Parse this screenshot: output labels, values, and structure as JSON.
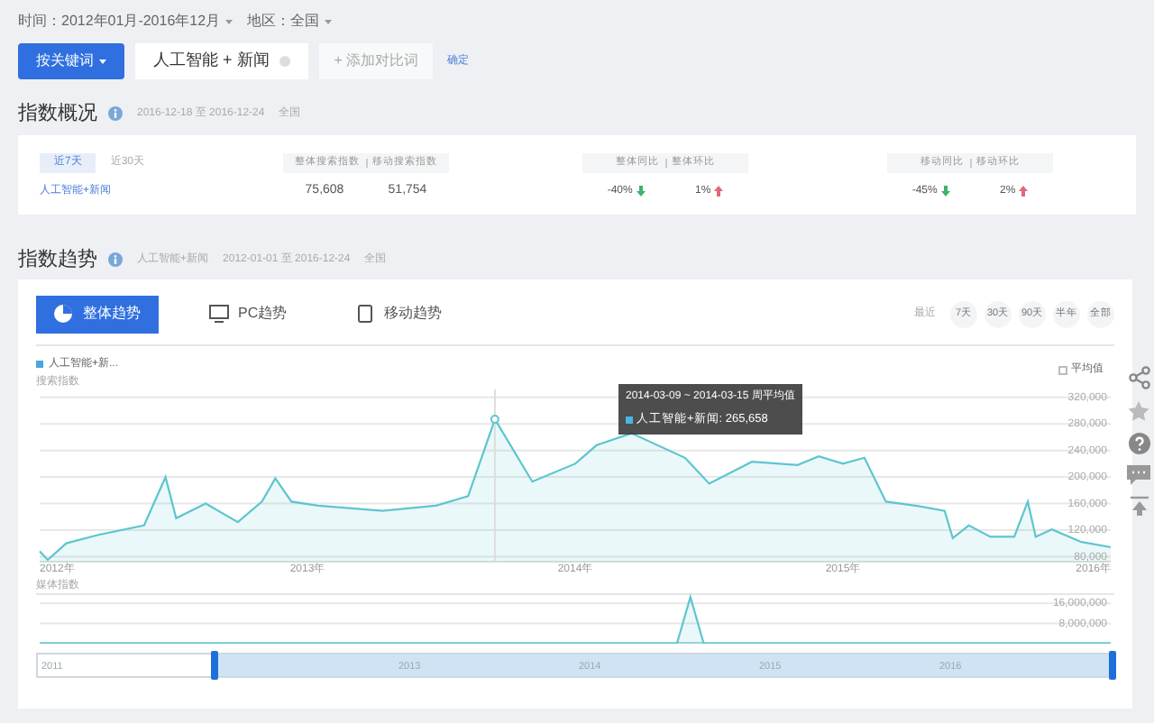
{
  "filters": [
    {
      "label": "时间：2012年01月-2016年12月"
    },
    {
      "label": "地区：全国"
    }
  ],
  "toolbar": {
    "mode_button": "按关键词",
    "keyword": "人工智能 + 新闻",
    "add_compare": "+ 添加对比词",
    "confirm": "确定"
  },
  "overview": {
    "title": "指数概况",
    "date_range": "2016-12-18 至 2016-12-24",
    "region": "全国",
    "tabs": [
      {
        "label": "近7天",
        "selected": true
      },
      {
        "label": "近30天",
        "selected": false
      }
    ],
    "header_groups": [
      [
        "整体搜索指数",
        "移动搜索指数"
      ],
      [
        "整体同比",
        "整体环比"
      ],
      [
        "移动同比",
        "移动环比"
      ]
    ],
    "row": {
      "keyword": "人工智能+新闻",
      "overall": "75,608",
      "mobile": "51,754",
      "changes": [
        {
          "value": "-40%",
          "rising": false
        },
        {
          "value": "1%",
          "rising": true
        },
        {
          "value": "-45%",
          "rising": false
        },
        {
          "value": "2%",
          "rising": true
        }
      ]
    }
  },
  "trend": {
    "title": "指数趋势",
    "keyword": "人工智能+新闻",
    "date_range": "2012-01-01 至 2016-12-24",
    "region": "全国",
    "tabs": [
      {
        "label": "整体趋势",
        "kind": "pie",
        "selected": true
      },
      {
        "label": "PC趋势",
        "kind": "monitor",
        "selected": false
      },
      {
        "label": "移动趋势",
        "kind": "phone",
        "selected": false
      }
    ],
    "range_label": "最近",
    "ranges": [
      {
        "label": "7天",
        "selected": false
      },
      {
        "label": "30天",
        "selected": false
      },
      {
        "label": "90天",
        "selected": false
      },
      {
        "label": "半年",
        "selected": false
      },
      {
        "label": "全部",
        "selected": false
      }
    ],
    "legend": "人工智能+新...",
    "average_toggle": {
      "label": "平均值",
      "checked": false
    },
    "tooltip": {
      "title": "2014-03-09 ~ 2014-03-15 周平均值",
      "label": "人工智能+新闻: 265,658"
    },
    "chart_data": {
      "type": "area",
      "ylabel": "搜索指数",
      "grid": true,
      "ref_lines": [
        {
          "axis": "x",
          "value": 2013.7
        }
      ],
      "xlim": [
        2012,
        2016
      ],
      "ylim": [
        71000,
        332000
      ],
      "x": [
        2012.0,
        2012.03,
        2012.1,
        2012.22,
        2012.39,
        2012.47,
        2012.51,
        2012.62,
        2012.74,
        2012.83,
        2012.88,
        2012.94,
        2013.04,
        2013.28,
        2013.48,
        2013.6,
        2013.7,
        2013.84,
        2014.0,
        2014.08,
        2014.21,
        2014.41,
        2014.5,
        2014.66,
        2014.83,
        2014.91,
        2015.0,
        2015.08,
        2015.16,
        2015.27,
        2015.38,
        2015.41,
        2015.47,
        2015.55,
        2015.64,
        2015.69,
        2015.72,
        2015.78,
        2015.89,
        2016.0
      ],
      "series": [
        {
          "color": "#5ec5cf",
          "values": [
            88000,
            75000,
            100000,
            113000,
            127000,
            200000,
            138000,
            160000,
            132000,
            163000,
            198000,
            163000,
            157000,
            149000,
            157000,
            171000,
            287000,
            193000,
            220000,
            248000,
            266000,
            229000,
            190000,
            223000,
            218000,
            231000,
            220000,
            229000,
            163000,
            157000,
            149000,
            108000,
            127000,
            110000,
            110000,
            163000,
            110000,
            121000,
            102000,
            94000
          ]
        }
      ],
      "xticks": [
        {
          "value": 2012,
          "label": "2012年"
        },
        {
          "value": 2013,
          "label": "2013年"
        },
        {
          "value": 2014,
          "label": "2014年"
        },
        {
          "value": 2015,
          "label": "2015年"
        },
        {
          "value": 2016,
          "label": "2016年"
        }
      ],
      "yticks": [
        {
          "value": 80000,
          "label": "80,000"
        },
        {
          "value": 120000,
          "label": "120,000"
        },
        {
          "value": 160000,
          "label": "160,000"
        },
        {
          "value": 200000,
          "label": "200,000"
        },
        {
          "value": 240000,
          "label": "240,000"
        },
        {
          "value": 280000,
          "label": "280,000"
        },
        {
          "value": 320000,
          "label": "320,000"
        }
      ]
    },
    "media": {
      "chart_data": {
        "type": "area",
        "ylabel": "媒体指数",
        "grid": true,
        "xlim": [
          2012,
          2016
        ],
        "ylim": [
          0,
          20000000
        ],
        "x": [
          2012.0,
          2014.38,
          2014.43,
          2014.48,
          2016.0
        ],
        "series": [
          {
            "color": "#5ec5cf",
            "values": [
              0,
              0,
              18500000,
              0,
              0
            ]
          }
        ],
        "yticks": [
          {
            "value": 8000000,
            "label": "8,000,000"
          },
          {
            "value": 16000000,
            "label": "16,000,000"
          }
        ]
      }
    },
    "navigator": {
      "labels": [
        "2011",
        "2013",
        "2014",
        "2015",
        "2016"
      ]
    }
  }
}
